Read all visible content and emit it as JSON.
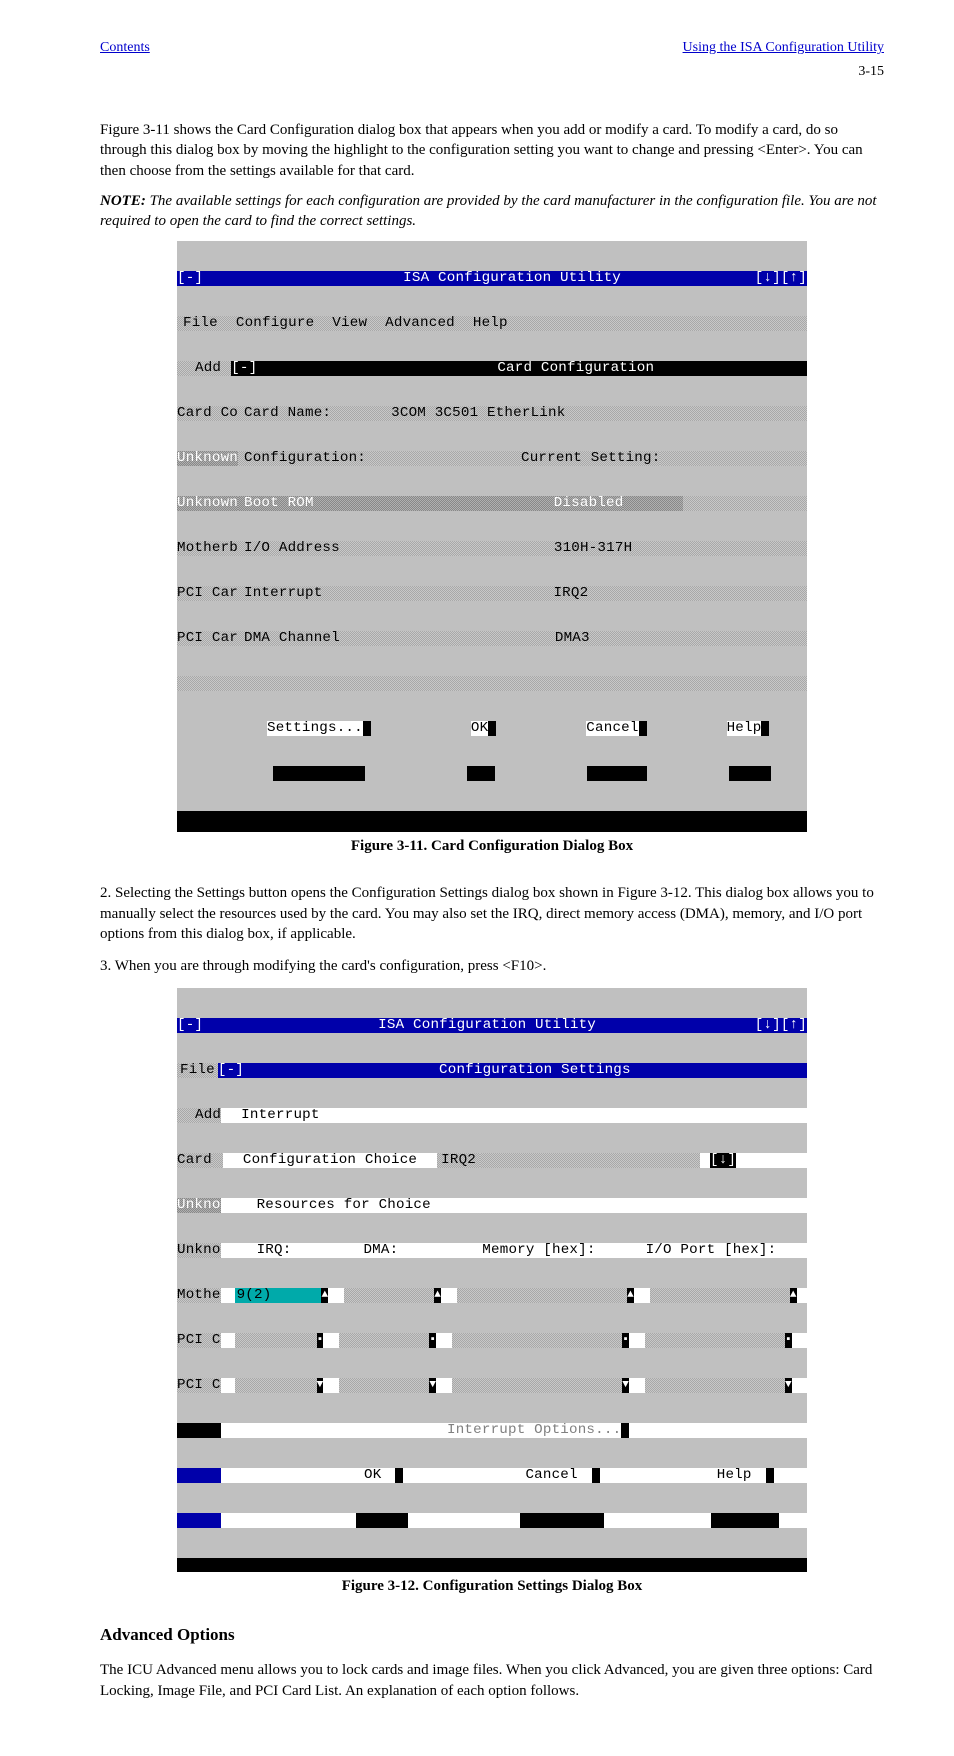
{
  "top_links": {
    "left": "Contents",
    "right": "Using the ISA Configuration Utility"
  },
  "page_number": "3-15",
  "intro": {
    "p1": "Figure 3-11 shows the Card Configuration dialog box that appears when you add or modify a card. To modify a card, do so through this dialog box by moving the highlight to the configuration setting you want to change and pressing <Enter>. You can then choose from the settings available for that card.",
    "note_label": "NOTE:",
    "note_body": " The available settings for each configuration are provided by the card manufacturer in the configuration file. You are not required to open the card to find the correct settings."
  },
  "figcap1": "Figure 3-11.  Card Configuration Dialog Box",
  "steps": {
    "s1": "2. Selecting the Settings button opens the Configuration Settings dialog box shown in Figure 3-12. This dialog box allows you to manually select the resources used by the card. You may also set the IRQ, direct memory access (DMA), memory, and I/O port options from this dialog box, if applicable.",
    "s2": "3. When you are through modifying the card's configuration, press <F10>."
  },
  "figcap2": "Figure 3-12.  Configuration Settings Dialog Box",
  "advanced_heading": "Advanced Options",
  "advanced_body": "The ICU Advanced menu allows you to lock cards and image files. When you click Advanced, you are given three options: Card Locking, Image File, and PCI Card List. An explanation of each option follows.",
  "fig1": {
    "title_bar": "ISA Configuration Utility",
    "title_controls": "[↓][↑]",
    "minus": "[-]",
    "menu": [
      "File",
      "Configure",
      "View",
      "Advanced",
      "Help"
    ],
    "add": "Add",
    "sub_title": "Card Configuration",
    "card_co": "Card Co",
    "card_name_label": "Card Name:",
    "card_name_value": "3COM 3C501 EtherLink",
    "unknown": "Unknown",
    "config_label": "Configuration:",
    "current_setting": "Current Setting:",
    "rows": [
      {
        "left": "Unknown",
        "label": "Boot ROM",
        "value": "Disabled",
        "highlight": true
      },
      {
        "left": "Motherb",
        "label": "I/O Address",
        "value": "310H-317H"
      },
      {
        "left": "PCI Car",
        "label": "Interrupt",
        "value": "IRQ2"
      },
      {
        "left": "PCI Car",
        "label": "DMA Channel",
        "value": "DMA3"
      }
    ],
    "buttons": [
      "Settings...",
      "OK",
      "Cancel",
      "Help"
    ]
  },
  "fig2": {
    "title_bar": "ISA Configuration Utility",
    "title_controls": "[↓][↑]",
    "minus": "[-]",
    "file": "File",
    "sub_title": "Configuration Settings",
    "left_col": [
      "Add",
      "Card",
      "Unkno",
      "Unkno",
      "Mothe",
      "PCI C",
      "PCI C"
    ],
    "interrupt": "Interrupt",
    "conf_choice_label": "Configuration Choice",
    "conf_choice_value": "IRQ2",
    "dropdown": "[↓]",
    "res_label": "Resources for Choice",
    "cols": [
      "IRQ:",
      "DMA:",
      "Memory [hex]:",
      "I/O Port [hex]:"
    ],
    "irq_val": "9(2)",
    "interrupt_opts": "Interrupt Options...",
    "buttons": [
      "OK",
      "Cancel",
      "Help"
    ],
    "tri_up": "▲",
    "tri_dn": "▼"
  }
}
